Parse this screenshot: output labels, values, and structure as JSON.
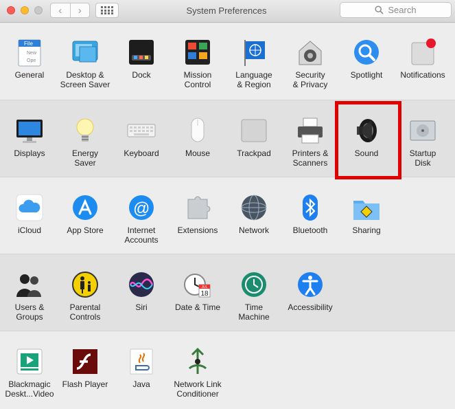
{
  "window": {
    "title": "System Preferences"
  },
  "toolbar": {
    "back_glyph": "‹",
    "forward_glyph": "›",
    "grid_icon": "grid-icon"
  },
  "search": {
    "placeholder": "Search"
  },
  "highlight_color": "#e00000",
  "rows": [
    [
      {
        "label": "General",
        "icon": "general-icon"
      },
      {
        "label": "Desktop &\nScreen Saver",
        "icon": "desktop-screensaver-icon"
      },
      {
        "label": "Dock",
        "icon": "dock-icon"
      },
      {
        "label": "Mission\nControl",
        "icon": "mission-control-icon"
      },
      {
        "label": "Language\n& Region",
        "icon": "language-region-icon"
      },
      {
        "label": "Security\n& Privacy",
        "icon": "security-privacy-icon"
      },
      {
        "label": "Spotlight",
        "icon": "spotlight-icon"
      },
      {
        "label": "Notifications",
        "icon": "notifications-icon"
      }
    ],
    [
      {
        "label": "Displays",
        "icon": "displays-icon"
      },
      {
        "label": "Energy\nSaver",
        "icon": "energy-saver-icon"
      },
      {
        "label": "Keyboard",
        "icon": "keyboard-icon"
      },
      {
        "label": "Mouse",
        "icon": "mouse-icon"
      },
      {
        "label": "Trackpad",
        "icon": "trackpad-icon"
      },
      {
        "label": "Printers &\nScanners",
        "icon": "printers-scanners-icon"
      },
      {
        "label": "Sound",
        "icon": "sound-icon",
        "highlighted": true
      },
      {
        "label": "Startup\nDisk",
        "icon": "startup-disk-icon"
      }
    ],
    [
      {
        "label": "iCloud",
        "icon": "icloud-icon"
      },
      {
        "label": "App Store",
        "icon": "app-store-icon"
      },
      {
        "label": "Internet\nAccounts",
        "icon": "internet-accounts-icon"
      },
      {
        "label": "Extensions",
        "icon": "extensions-icon"
      },
      {
        "label": "Network",
        "icon": "network-icon"
      },
      {
        "label": "Bluetooth",
        "icon": "bluetooth-icon"
      },
      {
        "label": "Sharing",
        "icon": "sharing-icon"
      }
    ],
    [
      {
        "label": "Users &\nGroups",
        "icon": "users-groups-icon"
      },
      {
        "label": "Parental\nControls",
        "icon": "parental-controls-icon"
      },
      {
        "label": "Siri",
        "icon": "siri-icon"
      },
      {
        "label": "Date & Time",
        "icon": "date-time-icon",
        "month": "JUL",
        "day": "18"
      },
      {
        "label": "Time\nMachine",
        "icon": "time-machine-icon"
      },
      {
        "label": "Accessibility",
        "icon": "accessibility-icon"
      }
    ],
    [
      {
        "label": "Blackmagic\nDeskt...Video",
        "icon": "blackmagic-desktop-video-icon"
      },
      {
        "label": "Flash Player",
        "icon": "flash-player-icon"
      },
      {
        "label": "Java",
        "icon": "java-icon"
      },
      {
        "label": "Network Link\nConditioner",
        "icon": "network-link-conditioner-icon"
      }
    ]
  ]
}
